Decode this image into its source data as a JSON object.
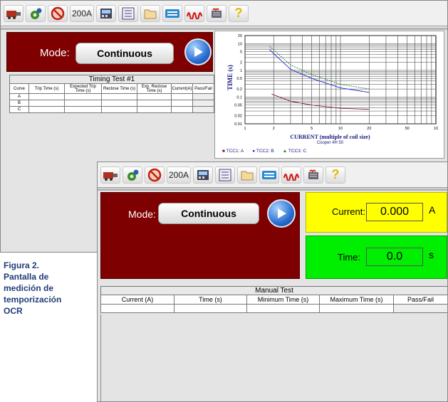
{
  "toolbar": {
    "amp_label": "200A",
    "help_label": "?",
    "icons": [
      "relay-test-icon",
      "settings-gear-icon",
      "prohibit-icon",
      "amp-200-button",
      "meter-icon",
      "document-list-icon",
      "folder-icon",
      "keyboard-panel-icon",
      "waveform-icon",
      "heater-icon",
      "help-icon"
    ]
  },
  "colors": {
    "mode_panel": "#7f0000",
    "current_panel": "#ffff00",
    "time_panel": "#00ee00",
    "caption": "#1f3c78"
  },
  "back_window": {
    "mode_label": "Mode:",
    "mode_value": "Continuous",
    "timing_test": {
      "title": "Timing Test #1",
      "headers": [
        "Curve",
        "Trip Time (s)",
        "Expected Trip Time (s)",
        "Reclose Time (s)",
        "Exp. Reclose Time (s)",
        "Current(A)",
        "Pass/Fail"
      ],
      "rows": [
        "A",
        "B",
        "C"
      ]
    },
    "chart": {
      "ylabel": "TIME (s)",
      "xlabel": "CURRENT (multiple of coil size)",
      "subtitle": "Cooper 4H 50",
      "y_ticks": [
        "20",
        "10",
        "5",
        "2",
        "1",
        "0.5",
        "0.2",
        "0.1",
        "0.05",
        "0.02",
        "0.01"
      ],
      "x_ticks": [
        "1",
        "2",
        "5",
        "10",
        "20",
        "50",
        "10"
      ],
      "legend": [
        {
          "label": "TCC1: A",
          "marker": "square",
          "color": "#7a1a3a"
        },
        {
          "label": "TCC2: B",
          "marker": "circle",
          "color": "#2222cc"
        },
        {
          "label": "TCC3: C",
          "marker": "triangle",
          "color": "#1a7a2a"
        }
      ]
    }
  },
  "front_window": {
    "mode_label": "Mode:",
    "mode_value": "Continuous",
    "current": {
      "label": "Current:",
      "value": "0.000",
      "unit": "A"
    },
    "time": {
      "label": "Time:",
      "value": "0.0",
      "unit": "s"
    },
    "manual_test": {
      "title": "Manual Test",
      "headers": [
        "Current (A)",
        "Time (s)",
        "Minimum Time (s)",
        "Maximum Time (s)",
        "Pass/Fail"
      ]
    }
  },
  "caption": {
    "lines": [
      "Figura 2.",
      "Pantalla de",
      "medición de",
      "temporización",
      "OCR"
    ]
  }
}
